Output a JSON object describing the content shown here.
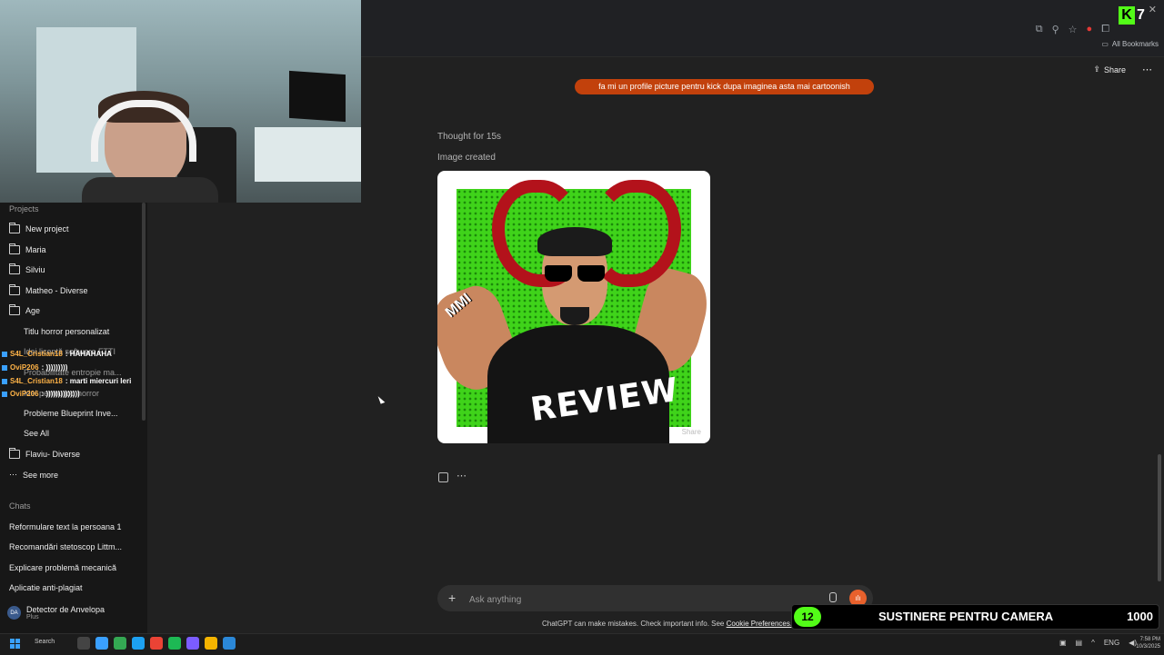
{
  "browser": {
    "bookmarks_label": "All Bookmarks",
    "kick_viewers": "7"
  },
  "header": {
    "share_label": "Share"
  },
  "sidebar": {
    "projects_heading": "Projects",
    "new_project": "New project",
    "folders": [
      {
        "label": "Maria"
      },
      {
        "label": "Silviu"
      },
      {
        "label": "Matheo - Diverse"
      },
      {
        "label": "Age"
      }
    ],
    "age_items": [
      {
        "label": "Titlu horror personalizat"
      },
      {
        "label": "Idei licență software FTTI"
      },
      {
        "label": "Probabilitate entropie ma..."
      },
      {
        "label": "Idei pentru joc horror"
      },
      {
        "label": "Probleme Blueprint Inve..."
      }
    ],
    "see_all": "See All",
    "folder_flaviu": "Flaviu- Diverse",
    "see_more": "See more",
    "chats_heading": "Chats",
    "chats": [
      {
        "label": "Reformulare text la persoana 1"
      },
      {
        "label": "Recomandări stetoscop Littm..."
      },
      {
        "label": "Explicare problemă mecanică"
      },
      {
        "label": "Aplicatie anti-plagiat"
      }
    ],
    "user": {
      "initials": "DA",
      "name": "Detector de Anvelopa",
      "plan": "Plus"
    }
  },
  "stream_chat": [
    {
      "user": "S4L_Cristian18",
      "msg": ": HAHAHAHA"
    },
    {
      "user": "OviP206",
      "msg": ": )))))))))"
    },
    {
      "user": "S4L_Cristian18",
      "msg": ": marti miercuri leri"
    },
    {
      "user": "OviP206",
      "msg": ": ))))))))))))))"
    }
  ],
  "conversation": {
    "user_message": "fa mi un profile picture pentru kick dupa imaginea asta mai cartoonish",
    "thought": "Thought for 15s",
    "image_created": "Image created",
    "image_text": "REVIEW",
    "image_tag": "MMI",
    "image_share": "Share"
  },
  "composer": {
    "placeholder": "Ask anything",
    "disclaimer": "ChatGPT can make mistakes. Check important info. See",
    "cookie_link": "Cookie Preferences."
  },
  "support_bar": {
    "count": "12",
    "label": "SUSTINERE PENTRU CAMERA",
    "goal": "1000"
  },
  "taskbar": {
    "search_label": "Search",
    "lang": "ENG",
    "time": "7:58 PM",
    "date": "10/3/2025"
  },
  "colors": {
    "accent": "#e8612c",
    "user_bubble": "#c2410c",
    "kick_green": "#53fc18"
  }
}
